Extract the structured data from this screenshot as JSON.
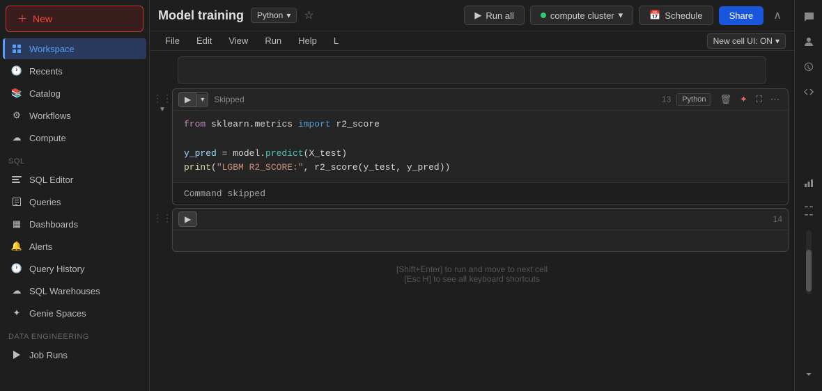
{
  "app": {
    "title": "Model training",
    "language": "Python",
    "new_button_label": "New"
  },
  "sidebar": {
    "items": [
      {
        "id": "workspace",
        "label": "Workspace",
        "active": true
      },
      {
        "id": "recents",
        "label": "Recents"
      },
      {
        "id": "catalog",
        "label": "Catalog"
      },
      {
        "id": "workflows",
        "label": "Workflows"
      },
      {
        "id": "compute",
        "label": "Compute"
      }
    ],
    "sql_section": "SQL",
    "sql_items": [
      {
        "id": "sql-editor",
        "label": "SQL Editor"
      },
      {
        "id": "queries",
        "label": "Queries"
      },
      {
        "id": "dashboards",
        "label": "Dashboards"
      },
      {
        "id": "alerts",
        "label": "Alerts"
      },
      {
        "id": "query-history",
        "label": "Query History"
      },
      {
        "id": "sql-warehouses",
        "label": "SQL Warehouses"
      },
      {
        "id": "genie-spaces",
        "label": "Genie Spaces"
      }
    ],
    "data_engineering_section": "Data Engineering",
    "data_engineering_items": [
      {
        "id": "job-runs",
        "label": "Job Runs"
      }
    ]
  },
  "header": {
    "title": "Model training",
    "language_badge": "Python",
    "run_all_label": "Run all",
    "compute_label": "compute cluster",
    "schedule_label": "Schedule",
    "share_label": "Share"
  },
  "menubar": {
    "items": [
      "File",
      "Edit",
      "View",
      "Run",
      "Help",
      "L"
    ],
    "new_cell_ui": "New cell UI: ON"
  },
  "cells": [
    {
      "id": "cell-13",
      "status": "Skipped",
      "num": 13,
      "lang": "Python",
      "code_lines": [
        {
          "type": "code",
          "content": "from sklearn.metrics import r2_score"
        },
        {
          "type": "blank"
        },
        {
          "type": "code",
          "content": "y_pred = model.predict(X_test)"
        },
        {
          "type": "code",
          "content": "print(\"LGBM R2_SCORE:\", r2_score(y_test, y_pred))"
        }
      ],
      "output": "Command skipped"
    },
    {
      "id": "cell-14",
      "status": "",
      "num": 14,
      "code_lines": []
    }
  ],
  "hints": {
    "run_hint": "[Shift+Enter] to run and move to next cell",
    "shortcut_hint": "[Esc H] to see all keyboard shortcuts"
  },
  "right_panel": {
    "icons": [
      "chat",
      "person",
      "history",
      "code",
      "chart",
      "settings-bottom"
    ]
  }
}
